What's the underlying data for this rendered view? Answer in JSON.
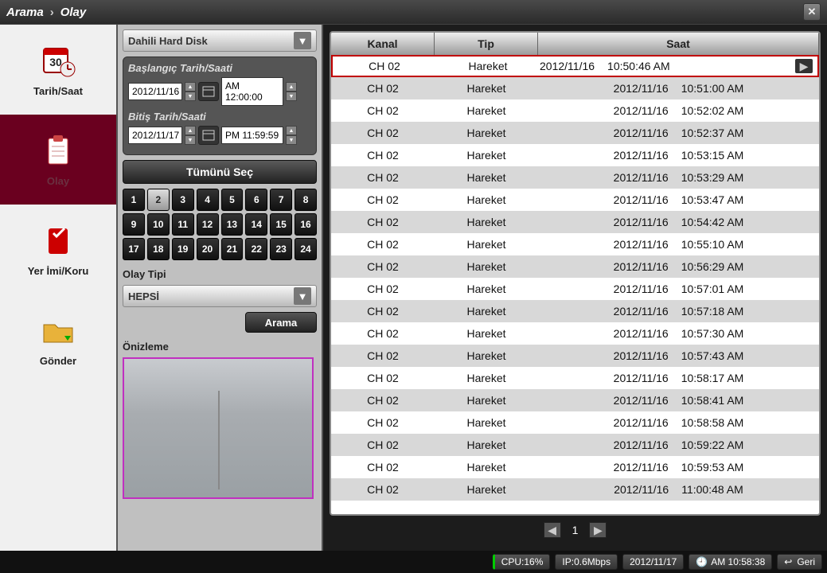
{
  "title": {
    "crumb1": "Arama",
    "crumb2": "Olay"
  },
  "leftnav": {
    "items": [
      {
        "label": "Tarih/Saat"
      },
      {
        "label": "Olay"
      },
      {
        "label": "Yer İmi/Koru"
      },
      {
        "label": "Gönder"
      }
    ]
  },
  "storage_dropdown": "Dahili Hard Disk",
  "datetime": {
    "start_label": "Başlangıç Tarih/Saati",
    "start_date": "2012/11/16",
    "start_time": "AM 12:00:00",
    "end_label": "Bitiş Tarih/Saati",
    "end_date": "2012/11/17",
    "end_time": "PM 11:59:59"
  },
  "select_all": "Tümünü Seç",
  "channels": [
    "1",
    "2",
    "3",
    "4",
    "5",
    "6",
    "7",
    "8",
    "9",
    "10",
    "11",
    "12",
    "13",
    "14",
    "15",
    "16",
    "17",
    "18",
    "19",
    "20",
    "21",
    "22",
    "23",
    "24"
  ],
  "channel_selected_index": 1,
  "event_type_label": "Olay Tipi",
  "event_type_value": "HEPSİ",
  "search_btn": "Arama",
  "preview_label": "Önizleme",
  "table": {
    "headers": {
      "ch": "Kanal",
      "tp": "Tip",
      "dt": "Saat"
    },
    "rows": [
      {
        "ch": "CH 02",
        "tp": "Hareket",
        "date": "2012/11/16",
        "time": "10:50:46 AM",
        "selected": true
      },
      {
        "ch": "CH 02",
        "tp": "Hareket",
        "date": "2012/11/16",
        "time": "10:51:00 AM"
      },
      {
        "ch": "CH 02",
        "tp": "Hareket",
        "date": "2012/11/16",
        "time": "10:52:02 AM"
      },
      {
        "ch": "CH 02",
        "tp": "Hareket",
        "date": "2012/11/16",
        "time": "10:52:37 AM"
      },
      {
        "ch": "CH 02",
        "tp": "Hareket",
        "date": "2012/11/16",
        "time": "10:53:15 AM"
      },
      {
        "ch": "CH 02",
        "tp": "Hareket",
        "date": "2012/11/16",
        "time": "10:53:29 AM"
      },
      {
        "ch": "CH 02",
        "tp": "Hareket",
        "date": "2012/11/16",
        "time": "10:53:47 AM"
      },
      {
        "ch": "CH 02",
        "tp": "Hareket",
        "date": "2012/11/16",
        "time": "10:54:42 AM"
      },
      {
        "ch": "CH 02",
        "tp": "Hareket",
        "date": "2012/11/16",
        "time": "10:55:10 AM"
      },
      {
        "ch": "CH 02",
        "tp": "Hareket",
        "date": "2012/11/16",
        "time": "10:56:29 AM"
      },
      {
        "ch": "CH 02",
        "tp": "Hareket",
        "date": "2012/11/16",
        "time": "10:57:01 AM"
      },
      {
        "ch": "CH 02",
        "tp": "Hareket",
        "date": "2012/11/16",
        "time": "10:57:18 AM"
      },
      {
        "ch": "CH 02",
        "tp": "Hareket",
        "date": "2012/11/16",
        "time": "10:57:30 AM"
      },
      {
        "ch": "CH 02",
        "tp": "Hareket",
        "date": "2012/11/16",
        "time": "10:57:43 AM"
      },
      {
        "ch": "CH 02",
        "tp": "Hareket",
        "date": "2012/11/16",
        "time": "10:58:17 AM"
      },
      {
        "ch": "CH 02",
        "tp": "Hareket",
        "date": "2012/11/16",
        "time": "10:58:41 AM"
      },
      {
        "ch": "CH 02",
        "tp": "Hareket",
        "date": "2012/11/16",
        "time": "10:58:58 AM"
      },
      {
        "ch": "CH 02",
        "tp": "Hareket",
        "date": "2012/11/16",
        "time": "10:59:22 AM"
      },
      {
        "ch": "CH 02",
        "tp": "Hareket",
        "date": "2012/11/16",
        "time": "10:59:53 AM"
      },
      {
        "ch": "CH 02",
        "tp": "Hareket",
        "date": "2012/11/16",
        "time": "11:00:48 AM"
      }
    ]
  },
  "pager": {
    "page": "1"
  },
  "status": {
    "cpu": "CPU:16%",
    "ip": "IP:0.6Mbps",
    "date": "2012/11/17",
    "time": "AM 10:58:38",
    "back": "Geri"
  }
}
